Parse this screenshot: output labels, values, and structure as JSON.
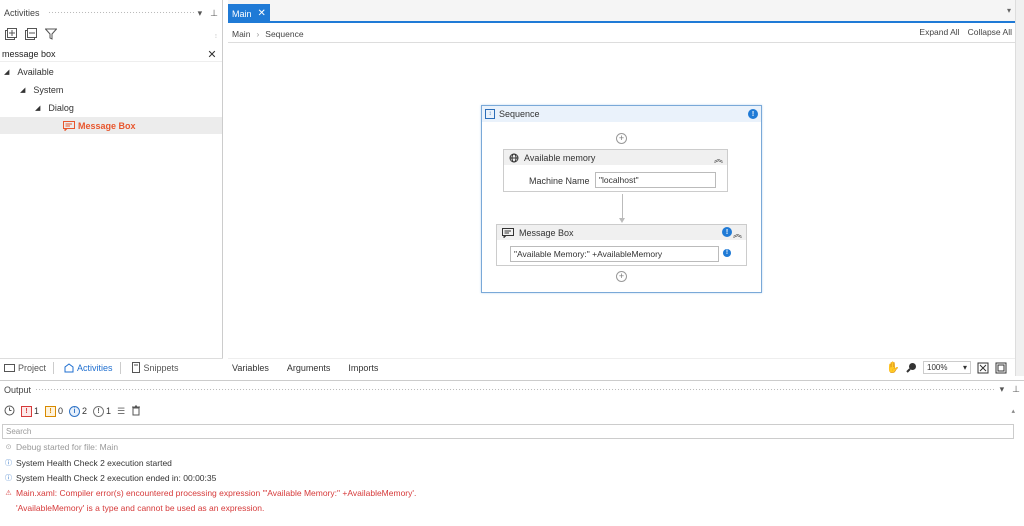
{
  "activities": {
    "title": "Activities",
    "search_value": "message box",
    "tree": {
      "l1": "Available",
      "l2": "System",
      "l3": "Dialog",
      "l4": "Message Box"
    },
    "tabs": {
      "project": "Project",
      "activities": "Activities",
      "snippets": "Snippets"
    }
  },
  "designer": {
    "tab_label": "Main",
    "breadcrumb": {
      "root": "Main",
      "current": "Sequence"
    },
    "expand_all": "Expand All",
    "collapse_all": "Collapse All",
    "sequence": {
      "title": "Sequence",
      "available_memory": {
        "title": "Available memory",
        "field_label": "Machine Name",
        "field_value": "\"localhost\""
      },
      "message_box": {
        "title": "Message Box",
        "expression": "\"Available Memory:\" +AvailableMemory"
      }
    },
    "bottom": {
      "variables": "Variables",
      "arguments": "Arguments",
      "imports": "Imports",
      "zoom": "100%"
    }
  },
  "output": {
    "title": "Output",
    "counts": {
      "errors": "1",
      "warnings": "0",
      "info": "2",
      "trace": "1"
    },
    "search_placeholder": "Search",
    "lines": [
      "Debug started for file: Main",
      "System Health Check 2 execution started",
      "System Health Check 2 execution ended in: 00:00:35",
      "Main.xaml: Compiler error(s) encountered processing expression '\"Available Memory:\" +AvailableMemory'.",
      "'AvailableMemory' is a type and cannot be used as an expression."
    ]
  },
  "colors": {
    "accent": "#1f7ad6",
    "highlight": "#e8572e",
    "error": "#d63a3a"
  }
}
